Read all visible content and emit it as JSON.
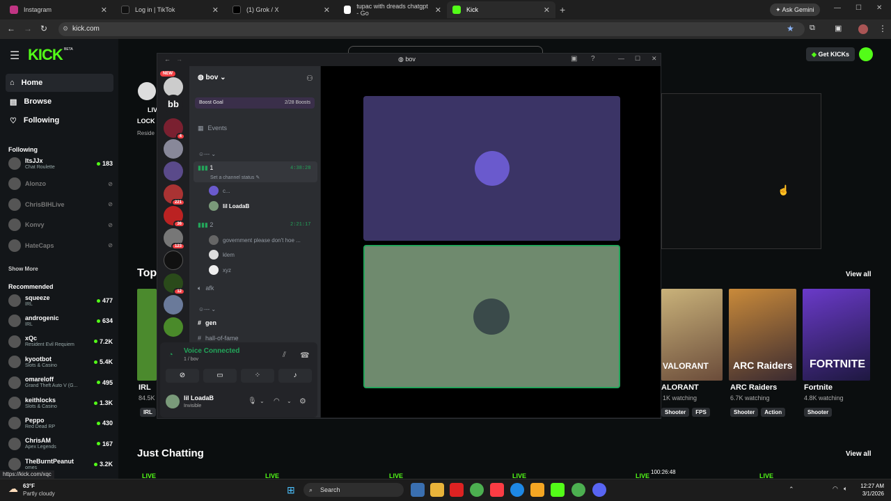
{
  "browser": {
    "tabs": [
      {
        "title": "Instagram"
      },
      {
        "title": "Log in | TikTok"
      },
      {
        "title": "(1) Grok / X"
      },
      {
        "title": "tupac with dreads chatgpt - Go"
      },
      {
        "title": "Kick"
      }
    ],
    "ask_gemini": "Ask Gemini",
    "url": "kick.com",
    "status_url": "https://kick.com/xqc"
  },
  "kick": {
    "logo": "KICK",
    "beta": "BETA",
    "nav": [
      "Home",
      "Browse",
      "Following"
    ],
    "following_title": "Following",
    "following": [
      {
        "name": "ItsJJx",
        "sub": "Chat Roulette",
        "count": "183",
        "live": true
      },
      {
        "name": "Alonzo",
        "sub": "",
        "count": "",
        "live": false
      },
      {
        "name": "ChrisBIHLive",
        "sub": "",
        "count": "",
        "live": false
      },
      {
        "name": "Konvy",
        "sub": "",
        "count": "",
        "live": false
      },
      {
        "name": "HateCaps",
        "sub": "",
        "count": "",
        "live": false
      }
    ],
    "show_more": "Show More",
    "recommended_title": "Recommended",
    "recommended": [
      {
        "name": "squeeze",
        "sub": "IRL",
        "count": "477"
      },
      {
        "name": "androgenic",
        "sub": "IRL",
        "count": "634"
      },
      {
        "name": "xQc",
        "sub": "Resident Evil Requiem",
        "count": "7.2K"
      },
      {
        "name": "kyootbot",
        "sub": "Slots & Casino",
        "count": "5.4K"
      },
      {
        "name": "omareloff",
        "sub": "Grand Theft Auto V (G...",
        "count": "495"
      },
      {
        "name": "keithlocks",
        "sub": "Slots & Casino",
        "count": "1.3K"
      },
      {
        "name": "Peppo",
        "sub": "Red Dead RP",
        "count": "430"
      },
      {
        "name": "ChrisAM",
        "sub": "Apex Legends",
        "count": "167"
      },
      {
        "name": "TheBurntPeanut",
        "sub": "omes",
        "count": "3.2K"
      }
    ],
    "get_kicks": "Get KICKs",
    "top_label": "Top",
    "view_all": "View all",
    "just_chatting": "Just Chatting",
    "live": "LIVE",
    "live_fragments": [
      "LIVE",
      "LOCK",
      "Reside"
    ],
    "categories": [
      {
        "title": "IRL",
        "watching": "84.5K",
        "tags": [
          "IRL"
        ]
      },
      {
        "title": "ALORANT",
        "watching": "1K watching",
        "tags": [
          "Shooter",
          "FPS"
        ]
      },
      {
        "title": "ARC Raiders",
        "watching": "6.7K watching",
        "tags": [
          "Shooter",
          "Action"
        ]
      },
      {
        "title": "Fortnite",
        "watching": "4.8K watching",
        "tags": [
          "Shooter"
        ]
      }
    ],
    "card_art": [
      "VALORANT",
      "ARC Raiders",
      "FORTNITE"
    ],
    "timer_fragment": "100:26:48"
  },
  "discord": {
    "window_title": "bov",
    "new_badge": "NEW",
    "server_name": "bov",
    "boost_goal": "Boost Goal",
    "boosts": "2/28 Boosts",
    "events": "Events",
    "category_1": "---",
    "voice_channels": [
      {
        "name": "1",
        "time": "4:38:28",
        "status": "Set a channel status",
        "users": [
          "c...",
          "lil LoadaB"
        ]
      },
      {
        "name": "2",
        "time": "2:21:17",
        "status": "",
        "users": [
          "government please don't hoe ...",
          "klem",
          "xyz"
        ]
      }
    ],
    "afk": "afk",
    "category_2": "---",
    "text_channels": [
      "gen",
      "hall-of-fame"
    ],
    "voice_connected": "Voice Connected",
    "voice_location": "1 / bov",
    "user_name": "lil LoadaB",
    "user_status": "Invisible",
    "guild_badges": [
      "4",
      "221",
      "36",
      "123",
      "12"
    ],
    "guild_initials": "bb",
    "stage_tile_colors": [
      "#3b3466",
      "#6f8a6e"
    ]
  },
  "taskbar": {
    "weather_temp": "63°F",
    "weather_desc": "Partly cloudy",
    "search": "Search",
    "time": "12:27 AM",
    "date": "3/1/2026"
  }
}
